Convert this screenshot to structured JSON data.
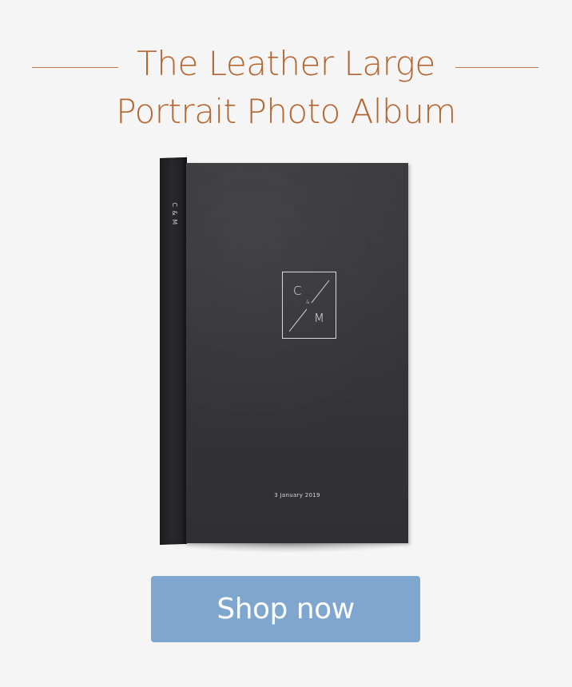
{
  "headline": {
    "line1": "The Leather Large",
    "line2": "Portrait Photo Album"
  },
  "album": {
    "spine_text": "C & M",
    "monogram_c": "C",
    "monogram_amp": "&",
    "monogram_m": "M",
    "date": "3 January 2019"
  },
  "cta": {
    "label": "Shop now"
  },
  "colors": {
    "title": "#b5652f",
    "button": "#7ea6cf",
    "background": "#f5f5f5"
  }
}
